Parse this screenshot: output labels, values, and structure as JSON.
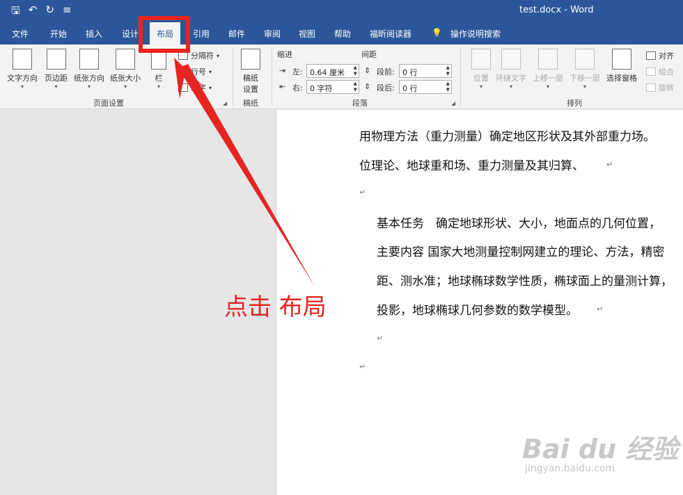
{
  "title_bar": {
    "quick_access": [
      "save-icon",
      "undo-icon",
      "redo-icon",
      "customize-icon"
    ],
    "title": "test.docx  -  Word"
  },
  "tabs": [
    "文件",
    "开始",
    "插入",
    "设计",
    "布局",
    "引用",
    "邮件",
    "审阅",
    "视图",
    "帮助",
    "福昕阅读器",
    "操作说明搜索"
  ],
  "active_tab": "布局",
  "ribbon": {
    "page_setup": {
      "label": "页面设置",
      "buttons": [
        "文字方向",
        "页边距",
        "纸张方向",
        "纸张大小",
        "栏"
      ],
      "small": [
        "分隔符",
        "行号",
        "断字"
      ]
    },
    "manuscript": {
      "label": "稿纸",
      "button": "稿纸\n设置"
    },
    "paragraph": {
      "label": "段落",
      "indent_header": "缩进",
      "spacing_header": "间距",
      "indent_left_label": "左:",
      "indent_left_value": "0.64 厘米",
      "indent_right_label": "右:",
      "indent_right_value": "0 字符",
      "spacing_before_label": "段前:",
      "spacing_before_value": "0 行",
      "spacing_after_label": "段后:",
      "spacing_after_value": "0 行"
    },
    "arrange": {
      "label": "排列",
      "buttons": [
        "位置",
        "环绕文字",
        "上移一层",
        "下移一层",
        "选择窗格"
      ],
      "small": [
        "对齐",
        "组合",
        "旋转"
      ]
    }
  },
  "document": {
    "lines": [
      "用物理方法（重力测量）确定地区形状及其外部重力场。",
      "位理论、地球重和场、重力测量及其归算、",
      "基本任务　确定地球形状、大小，地面点的几何位置，",
      "主要内容  国家大地测量控制网建立的理论、方法，精密",
      "距、测水准；地球椭球数学性质，椭球面上的量测计算，",
      "投影，地球椭球几何参数的数学模型。"
    ],
    "paragraph_mark": "↵"
  },
  "annotation": {
    "text": "点击 布局",
    "color": "#e52521"
  },
  "watermark": {
    "brand": "Bai du 经验",
    "url": "jingyan.baidu.com"
  },
  "colors": {
    "title_bar": "#2b579a",
    "ribbon": "#f3f3f3",
    "annotation_red": "#e52521"
  }
}
